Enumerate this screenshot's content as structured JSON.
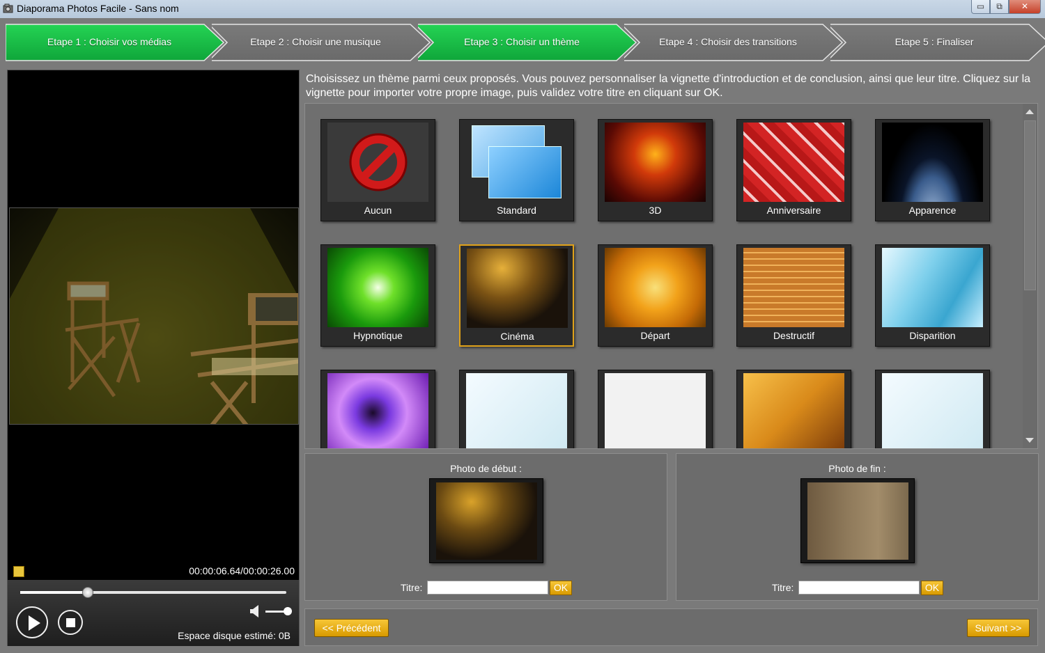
{
  "window": {
    "title": "Diaporama Photos Facile - Sans nom",
    "buttons": {
      "minimize": "▭",
      "maximize": "⧉",
      "close": "✕"
    }
  },
  "steps": [
    {
      "label": "Etape 1 : Choisir vos médias",
      "state": "done",
      "color": "#25d354"
    },
    {
      "label": "Etape 2 : Choisir une musique",
      "state": "pending",
      "color": "#7a7a7a"
    },
    {
      "label": "Etape 3 : Choisir un thème",
      "state": "active",
      "color": "#25d354"
    },
    {
      "label": "Etape 4 : Choisir des transitions",
      "state": "pending",
      "color": "#7a7a7a"
    },
    {
      "label": "Etape 5 : Finaliser",
      "state": "pending",
      "color": "#7a7a7a"
    }
  ],
  "preview": {
    "timecode": "00:00:06.64/00:00:26.00",
    "progress": 0.255,
    "volume": 0.85,
    "disk_space": "Espace disque estimé: 0B"
  },
  "instructions": "Choisissez un thème parmi ceux proposés. Vous pouvez personnaliser la vignette d'introduction et de conclusion, ainsi que leur titre. Cliquez sur la vignette pour importer votre propre image, puis validez votre titre en cliquant sur OK.",
  "themes": [
    {
      "name": "Aucun",
      "icon": "no-entry-icon"
    },
    {
      "name": "Standard",
      "icon": "windows-icon"
    },
    {
      "name": "3D"
    },
    {
      "name": "Anniversaire"
    },
    {
      "name": "Apparence"
    },
    {
      "name": "Hypnotique"
    },
    {
      "name": "Cinéma",
      "selected": true
    },
    {
      "name": "Départ"
    },
    {
      "name": "Destructif"
    },
    {
      "name": "Disparition"
    },
    {
      "name": ""
    },
    {
      "name": ""
    },
    {
      "name": ""
    },
    {
      "name": ""
    },
    {
      "name": ""
    }
  ],
  "start_photo": {
    "label": "Photo de début :",
    "title_label": "Titre:",
    "title_value": "",
    "ok": "OK"
  },
  "end_photo": {
    "label": "Photo de fin :",
    "title_label": "Titre:",
    "title_value": "",
    "ok": "OK"
  },
  "nav": {
    "previous": "<< Précédent",
    "next": "Suivant >>"
  },
  "colors": {
    "accent_green": "#25d354",
    "accent_orange": "#e0a21a",
    "panel": "#6f6f6f"
  }
}
